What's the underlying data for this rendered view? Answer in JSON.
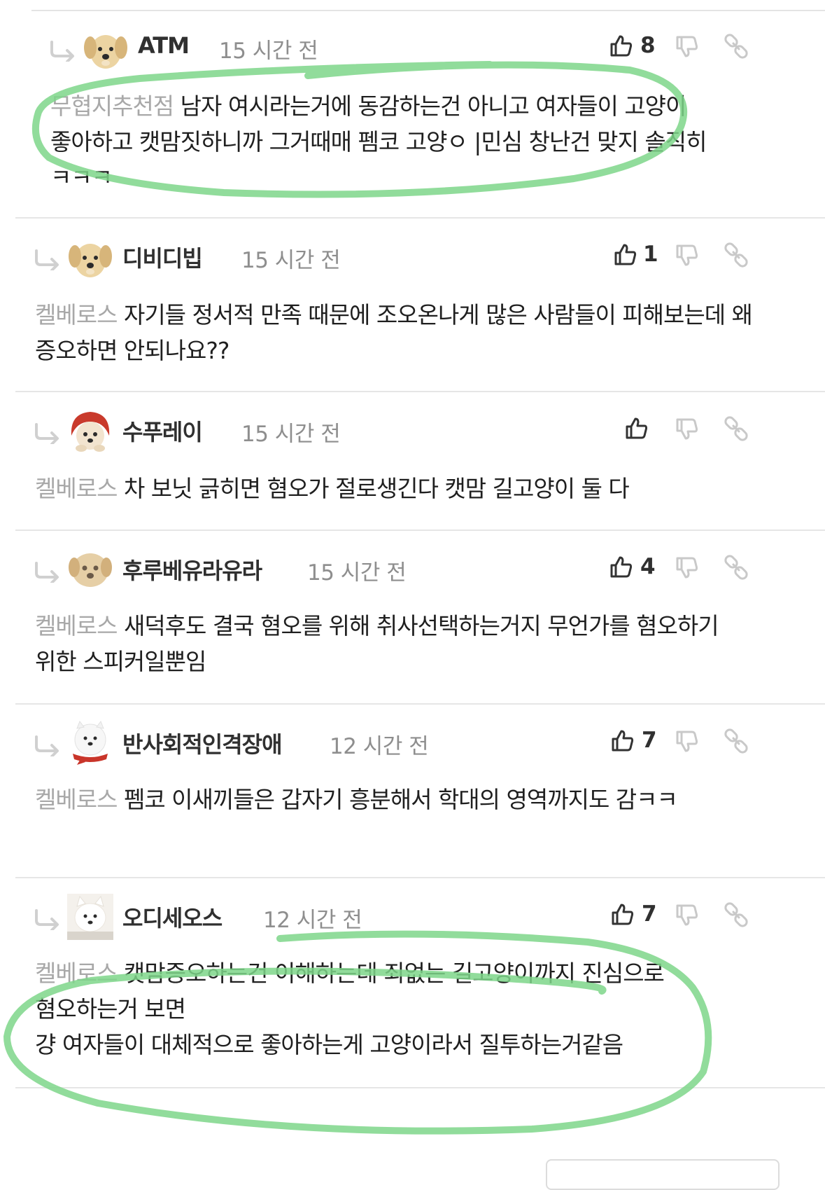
{
  "comments": [
    {
      "username": "ATM",
      "time": "15 시간 전",
      "likes": "8",
      "mention": "무협지추천점",
      "text": "남자 여시라는거에 동감하는건 아니고 여자들이 고양이 좋아하고 캣맘짓하니까 그거때매 펨코 고양ㅇ |민심 창난건 맞지 솔직히 ㅋㅋㅋ",
      "avatar": "puppy-avatar"
    },
    {
      "username": "디비디빕",
      "time": "15 시간 전",
      "likes": "1",
      "mention": "켈베로스",
      "text": "자기들 정서적 만족 때문에 조오온나게 많은 사람들이 피해보는데 왜 증오하면 안되나요??",
      "avatar": "puppy-avatar"
    },
    {
      "username": "수푸레이",
      "time": "15 시간 전",
      "likes": "",
      "mention": "켈베로스",
      "text": "차 보닛 긁히면 혐오가 절로생긴다 캣맘 길고양이 둘 다",
      "avatar": "red-hood-puppy-avatar"
    },
    {
      "username": "후루베유라유라",
      "time": "15 시간 전",
      "likes": "4",
      "mention": "켈베로스",
      "text": "새덕후도 결국 혐오를 위해 취사선택하는거지 무언가를 혐오하기 위한 스피커일뿐임",
      "avatar": "blurred-puppy-avatar"
    },
    {
      "username": "반사회적인격장애",
      "time": "12 시간 전",
      "likes": "7",
      "mention": "켈베로스",
      "text": "펨코 이새끼들은 갑자기 흥분해서 학대의 영역까지도 감ㅋㅋ",
      "avatar": "white-dog-scarf-avatar"
    },
    {
      "username": "오디세오스",
      "time": "12 시간 전",
      "likes": "7",
      "mention": "켈베로스",
      "text": "캣맘증오하는건 이해하는데 죄없는 길고양이까지 진심으로 혐오하는거 보면\n걍 여자들이 대체적으로 좋아하는게 고양이라서 질투하는거같음",
      "avatar": "white-dog-avatar"
    }
  ],
  "colors": {
    "highlight": "#7ed68a",
    "mention": "#a8a8a8",
    "time": "#8e8e8e"
  },
  "icons": {
    "reply": "reply-arrow-icon",
    "like": "thumbs-up-icon",
    "dislike": "thumbs-down-icon",
    "link": "link-icon"
  }
}
